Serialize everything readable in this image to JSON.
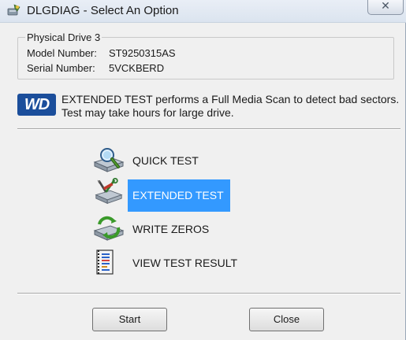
{
  "window": {
    "title": "DLGDIAG - Select An Option",
    "close_label": "✕"
  },
  "drive": {
    "group_title": "Physical Drive 3",
    "model_label": "Model Number:",
    "model_value": "ST9250315AS",
    "serial_label": "Serial Number:",
    "serial_value": "5VCKBERD"
  },
  "description": {
    "logo_text": "WD",
    "line1": "EXTENDED TEST performs a Full Media Scan to detect bad sectors.",
    "line2": "Test may take hours for large drive."
  },
  "options": [
    {
      "label": "QUICK TEST",
      "icon": "magnifier-drive-icon",
      "selected": false
    },
    {
      "label": "EXTENDED TEST",
      "icon": "tools-drive-icon",
      "selected": true
    },
    {
      "label": "WRITE ZEROS",
      "icon": "recycle-drive-icon",
      "selected": false
    },
    {
      "label": "VIEW TEST RESULT",
      "icon": "report-icon",
      "selected": false
    }
  ],
  "buttons": {
    "start": "Start",
    "close": "Close"
  },
  "colors": {
    "selection": "#3399ff",
    "wd_blue": "#1b4e9b",
    "background": "#f0f0f0"
  }
}
